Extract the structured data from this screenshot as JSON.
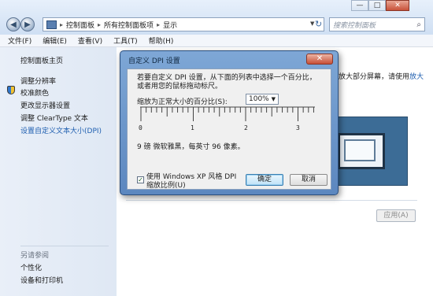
{
  "window": {
    "breadcrumbs": [
      "控制面板",
      "所有控制面板项",
      "显示"
    ],
    "search_placeholder": "搜索控制面板",
    "controls": {
      "min": "—",
      "max": "□",
      "close": "✕"
    }
  },
  "menubar": {
    "items": [
      "文件(F)",
      "编辑(E)",
      "查看(V)",
      "工具(T)",
      "帮助(H)"
    ]
  },
  "sidebar": {
    "home": "控制面板主页",
    "items": [
      "调整分辨率",
      "校准颜色",
      "更改显示器设置",
      "调整 ClearType 文本",
      "设置自定义文本大小(DPI)"
    ],
    "see_also_title": "另请参阅",
    "see_also": [
      "个性化",
      "设备和打印机"
    ]
  },
  "main": {
    "bg_text": "放大部分屏幕，请使用",
    "bg_link": "放大",
    "apply_label": "应用(A)"
  },
  "dialog": {
    "title": "自定义 DPI 设置",
    "close_label": "✕",
    "instruction": "若要自定义 DPI 设置，从下面的列表中选择一个百分比，或者用您的鼠标拖动标尺。",
    "scale_label": "缩放为正常大小的百分比(S):",
    "scale_value": "100%",
    "ruler_labels": [
      "0",
      "1",
      "2",
      "3"
    ],
    "sample_text": "9 磅 微软雅黑，每英寸 96 像素。",
    "xp_checkbox_label": "使用 Windows XP 风格 DPI 缩放比例(U)",
    "xp_checked": true,
    "ok_label": "确定",
    "cancel_label": "取消"
  }
}
